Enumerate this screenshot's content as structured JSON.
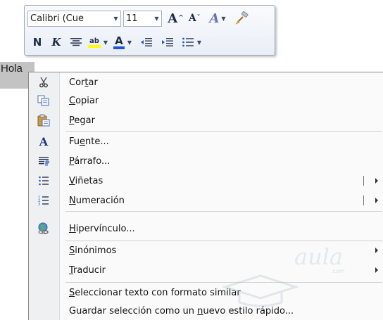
{
  "mini_toolbar": {
    "font_name": "Calibri (Cue",
    "font_size": "11",
    "grow_font_label": "A",
    "shrink_font_label": "A",
    "styles_label": "A",
    "bold_label": "N",
    "italic_label": "K",
    "highlight_label": "ab",
    "font_color_label": "A",
    "font_color_hex": "#1f54d8",
    "highlight_color_hex": "#ffff00"
  },
  "document": {
    "selected_text": "Hola"
  },
  "context_menu": {
    "items": [
      {
        "pre": "Cor",
        "accel": "t",
        "post": "ar",
        "icon": "scissors-icon"
      },
      {
        "pre": "",
        "accel": "C",
        "post": "opiar",
        "icon": "copy-icon"
      },
      {
        "pre": "",
        "accel": "P",
        "post": "egar",
        "icon": "paste-icon"
      },
      {
        "pre": "Fu",
        "accel": "e",
        "post": "nte...",
        "icon": "font-icon"
      },
      {
        "pre": "",
        "accel": "P",
        "post": "árrafo...",
        "icon": "paragraph-icon"
      },
      {
        "pre": "",
        "accel": "V",
        "post": "iñetas",
        "icon": "bullets-icon"
      },
      {
        "pre": "",
        "accel": "N",
        "post": "umeración",
        "icon": "numbering-icon"
      },
      {
        "pre": "",
        "accel": "H",
        "post": "ipervínculo...",
        "icon": "hyperlink-icon"
      },
      {
        "pre": "",
        "accel": "S",
        "post": "inónimos",
        "icon": ""
      },
      {
        "pre": "",
        "accel": "T",
        "post": "raducir",
        "icon": ""
      },
      {
        "pre": "",
        "accel": "S",
        "post": "eleccionar texto con formato similar",
        "icon": ""
      },
      {
        "pre": "Guardar selección como un ",
        "accel": "n",
        "post": "uevo estilo rápido...",
        "icon": ""
      }
    ]
  },
  "watermark": {
    "brand": "aula",
    "domain": ".com"
  }
}
